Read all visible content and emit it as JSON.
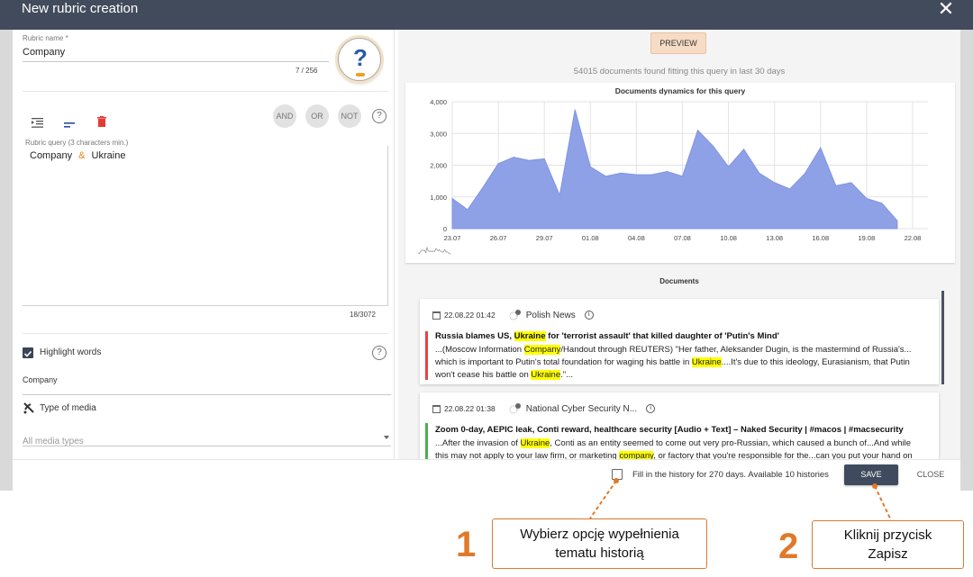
{
  "dialog": {
    "title": "New rubric creation",
    "close_symbol": "✕"
  },
  "left": {
    "rubric_name_label": "Rubric name *",
    "rubric_name_value": "Company",
    "rubric_name_counter": "7 / 256",
    "help_symbol": "?",
    "query_buttons": [
      "AND",
      "OR",
      "NOT"
    ],
    "query_help": "?",
    "query_label": "Rubric query (3 characters min.)",
    "query_term_1": "Company",
    "query_operator": "&",
    "query_term_2": "Ukraine",
    "query_counter": "18/3072",
    "highlight_label": "Highlight words",
    "highlight_help": "?",
    "highlight_value": "Company",
    "media_label": "Type of media",
    "media_placeholder": "All media types"
  },
  "right": {
    "preview_label": "PREVIEW",
    "found_text": "54015 documents found fitting this query in last 30 days",
    "documents_title": "Documents",
    "documents": [
      {
        "date": "22.08.22 01:42",
        "source": "Polish News",
        "bar_color": "#e84343",
        "title_parts": [
          "Russia blames US, ",
          "Ukraine",
          " for 'terrorist assault' that killed daughter of 'Putin's Mind'"
        ],
        "text_lines": [
          [
            "...(Moscow Information ",
            "Company",
            "/Handout through REUTERS) \"Her father, Aleksander Dugin, is the mastermind of Russia's..."
          ],
          [
            "which is important to Putin's total foundation for waging his battle in ",
            "Ukraine",
            "....It's due to this ideology, Eurasianism, that Putin"
          ],
          [
            "won't cease his battle on ",
            "Ukraine",
            ".\"..."
          ]
        ]
      },
      {
        "date": "22.08.22 01:38",
        "source": "National Cyber Security N...",
        "bar_color": "#4caf50",
        "title_parts": [
          "Zoom 0-day, AEPIC leak, Conti reward, healthcare security [Audio + Text] – Naked Security | #macos | #macsecurity",
          "",
          ""
        ],
        "text_lines": [
          [
            "...After the invasion of ",
            "Ukraine",
            ", Conti as an entity seemed to come out very pro-Russian, which caused a bunch of...And while"
          ],
          [
            "this may not apply to your law firm, or marketing ",
            "company",
            ", or factory that you're responsible for the...can you put your hand on"
          ]
        ]
      }
    ]
  },
  "footer": {
    "history_label": "Fill in the history for 270 days. Available 10 histories",
    "save_label": "SAVE",
    "close_label": "CLOSE"
  },
  "annotations": {
    "step1_number": "1",
    "step1_line1": "Wybierz opcję wypełnienia",
    "step1_line2": "tematu historią",
    "step2_number": "2",
    "step2_line1": "Kliknij przycisk",
    "step2_line2": "Zapisz"
  },
  "colors": {
    "header": "#424b5c",
    "accent_orange": "#e07a2a",
    "chart_fill": "#8fa1e6",
    "save_button": "#3f4a5e"
  },
  "chart_data": {
    "type": "area",
    "title": "Documents dynamics for this query",
    "xlabel": "",
    "ylabel": "",
    "categories": [
      "23.07",
      "24.07",
      "25.07",
      "26.07",
      "27.07",
      "28.07",
      "29.07",
      "30.07",
      "31.07",
      "01.08",
      "02.08",
      "03.08",
      "04.08",
      "05.08",
      "06.08",
      "07.08",
      "08.08",
      "09.08",
      "10.08",
      "11.08",
      "12.08",
      "13.08",
      "14.08",
      "15.08",
      "16.08",
      "17.08",
      "18.08",
      "19.08",
      "20.08",
      "21.08",
      "22.08",
      "23.08"
    ],
    "x_tick_labels": [
      "23.07",
      "26.07",
      "29.07",
      "01.08",
      "04.08",
      "07.08",
      "10.08",
      "13.08",
      "16.08",
      "19.08",
      "22.08"
    ],
    "series": [
      {
        "values": [
          950,
          600,
          1300,
          2050,
          2250,
          2150,
          2200,
          1050,
          3750,
          1950,
          1650,
          1750,
          1700,
          1700,
          1800,
          1650,
          3100,
          2600,
          1950,
          2500,
          1750,
          1450,
          1250,
          1750,
          2550,
          1350,
          1450,
          950,
          800,
          250
        ]
      }
    ],
    "ylim": [
      0,
      4000
    ],
    "y_ticks": [
      "0",
      "1,000",
      "2,000",
      "3,000",
      "4,000"
    ],
    "grid": true,
    "legend": "none"
  }
}
